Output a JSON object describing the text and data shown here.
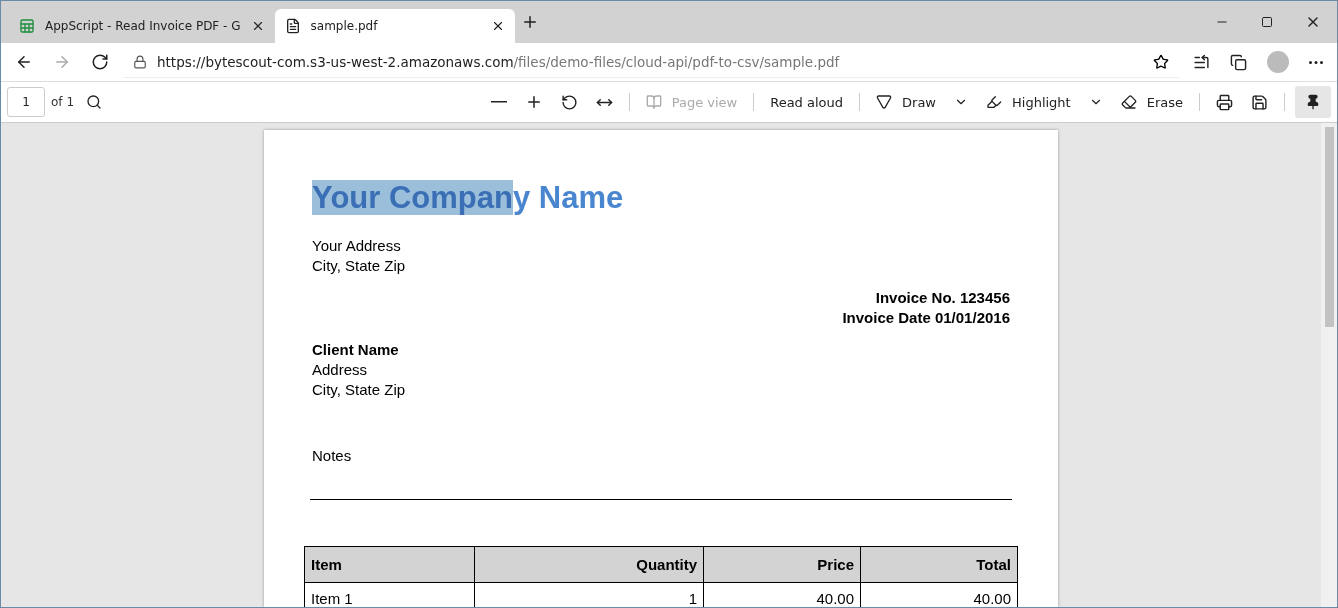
{
  "tabs": [
    {
      "title": "AppScript - Read Invoice PDF - G",
      "kind": "sheets",
      "selected": false
    },
    {
      "title": "sample.pdf",
      "kind": "file",
      "selected": true
    }
  ],
  "address_bar": {
    "host": "https://bytescout-com.s3-us-west-2.amazonaws.com",
    "path": "/files/demo-files/cloud-api/pdf-to-csv/sample.pdf"
  },
  "pdf_toolbar": {
    "page": "1",
    "page_count": "of 1",
    "page_view": {
      "label": "Page view",
      "disabled": true
    },
    "read_aloud": "Read aloud",
    "draw": "Draw",
    "highlight": "Highlight",
    "erase": "Erase",
    "pinned": true
  },
  "document": {
    "company_name": {
      "selected_part": "Your Compan",
      "unselected_part": "y Name"
    },
    "sender_address": [
      "Your Address",
      "City, State Zip"
    ],
    "invoice_lines": [
      "Invoice No. 123456",
      "Invoice Date 01/01/2016"
    ],
    "client_name": "Client Name",
    "client_address": [
      "Address",
      "City, State Zip"
    ],
    "notes": "Notes",
    "table": {
      "columns": [
        "Item",
        "Quantity",
        "Price",
        "Total"
      ],
      "rows": [
        [
          "Item 1",
          "1",
          "40.00",
          "40.00"
        ]
      ]
    }
  }
}
